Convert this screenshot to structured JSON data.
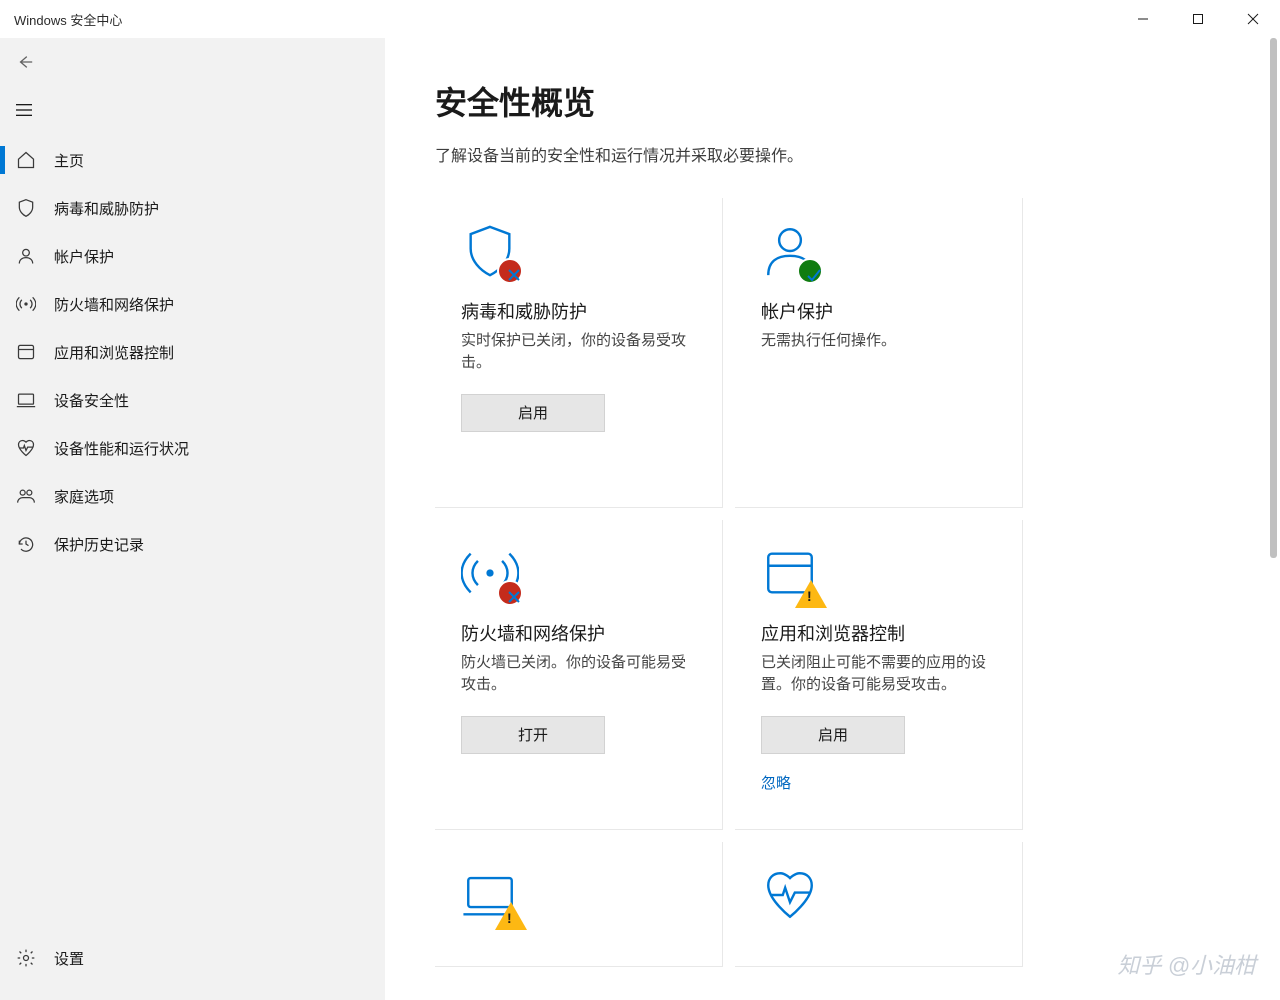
{
  "window": {
    "title": "Windows 安全中心"
  },
  "sidebar": {
    "items": [
      {
        "id": "home",
        "label": "主页",
        "icon": "home-icon",
        "active": true
      },
      {
        "id": "virus",
        "label": "病毒和威胁防护",
        "icon": "shield-icon"
      },
      {
        "id": "account",
        "label": "帐户保护",
        "icon": "person-icon"
      },
      {
        "id": "firewall",
        "label": "防火墙和网络保护",
        "icon": "radio-icon"
      },
      {
        "id": "appbrowser",
        "label": "应用和浏览器控制",
        "icon": "app-icon"
      },
      {
        "id": "devicesec",
        "label": "设备安全性",
        "icon": "device-icon"
      },
      {
        "id": "perf",
        "label": "设备性能和运行状况",
        "icon": "heart-icon"
      },
      {
        "id": "family",
        "label": "家庭选项",
        "icon": "family-icon"
      },
      {
        "id": "history",
        "label": "保护历史记录",
        "icon": "history-icon"
      }
    ],
    "settings_label": "设置"
  },
  "main": {
    "title": "安全性概览",
    "subtitle": "了解设备当前的安全性和运行情况并采取必要操作。",
    "cards": [
      {
        "title": "病毒和威胁防护",
        "desc": "实时保护已关闭，你的设备易受攻击。",
        "button": "启用",
        "status": "error",
        "icon": "shield-icon"
      },
      {
        "title": "帐户保护",
        "desc": "无需执行任何操作。",
        "button": "",
        "status": "ok",
        "icon": "person-icon"
      },
      {
        "title": "防火墙和网络保护",
        "desc": "防火墙已关闭。你的设备可能易受攻击。",
        "button": "打开",
        "status": "error",
        "icon": "radio-icon"
      },
      {
        "title": "应用和浏览器控制",
        "desc": "已关闭阻止可能不需要的应用的设置。你的设备可能易受攻击。",
        "button": "启用",
        "link": "忽略",
        "status": "warn",
        "icon": "app-icon"
      },
      {
        "title": "",
        "desc": "",
        "button": "",
        "status": "warn",
        "icon": "device-icon"
      },
      {
        "title": "",
        "desc": "",
        "button": "",
        "status": "none",
        "icon": "heart-icon"
      }
    ]
  },
  "watermark": "知乎 @小油柑"
}
